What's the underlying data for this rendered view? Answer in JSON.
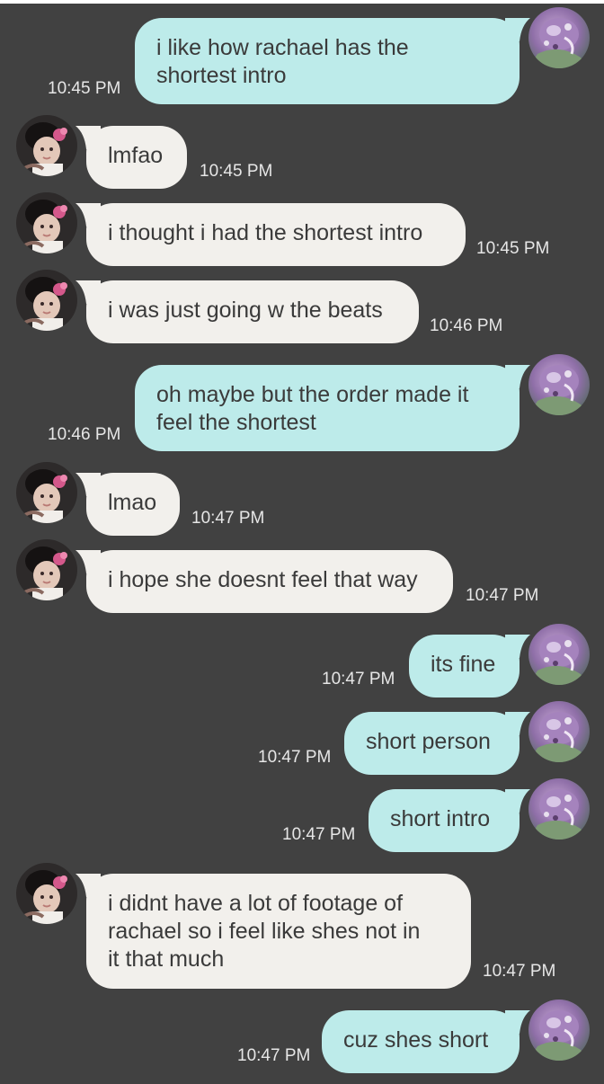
{
  "colors": {
    "background": "#414141",
    "incoming_bubble": "#f2f0ec",
    "outgoing_bubble": "#bdebea",
    "text": "#3a3a3a",
    "timestamp": "#e6e6e6"
  },
  "icons": {
    "self_avatar": "purple-figurine-avatar-icon",
    "other_avatar": "child-photo-avatar-icon"
  },
  "messages": [
    {
      "direction": "out",
      "lines": [
        "i like how rachael has the",
        "shortest intro"
      ],
      "time": "10:45 PM"
    },
    {
      "direction": "in",
      "lines": [
        "lmfao"
      ],
      "time": "10:45 PM"
    },
    {
      "direction": "in",
      "lines": [
        "i thought i had the shortest intro"
      ],
      "time": "10:45 PM"
    },
    {
      "direction": "in",
      "lines": [
        "i was just going w the beats"
      ],
      "time": "10:46 PM"
    },
    {
      "direction": "out",
      "lines": [
        "oh maybe but the order made it",
        "feel the shortest"
      ],
      "time": "10:46 PM"
    },
    {
      "direction": "in",
      "lines": [
        "lmao"
      ],
      "time": "10:47 PM"
    },
    {
      "direction": "in",
      "lines": [
        "i hope she doesnt feel that way"
      ],
      "time": "10:47 PM"
    },
    {
      "direction": "out",
      "lines": [
        "its fine"
      ],
      "time": "10:47 PM"
    },
    {
      "direction": "out",
      "lines": [
        "short person"
      ],
      "time": "10:47 PM"
    },
    {
      "direction": "out",
      "lines": [
        "short intro"
      ],
      "time": "10:47 PM"
    },
    {
      "direction": "in",
      "lines": [
        "i didnt have a lot of footage of",
        "rachael so i feel like shes not in",
        "it that much"
      ],
      "time": "10:47 PM"
    },
    {
      "direction": "out",
      "lines": [
        "cuz shes short"
      ],
      "time": "10:47 PM"
    }
  ]
}
